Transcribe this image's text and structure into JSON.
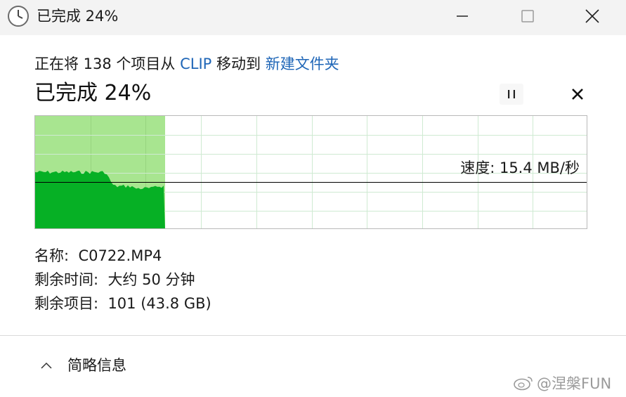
{
  "window": {
    "title": "已完成 24%"
  },
  "summary": {
    "prefix": "正在将 138 个项目从 ",
    "source": "CLIP",
    "middle": " 移动到 ",
    "destination": "新建文件夹"
  },
  "progress": {
    "percent_text": "已完成 24%",
    "percent_value": 24
  },
  "graph": {
    "speed_text": "速度: 15.4 MB/秒",
    "colors": {
      "fill_light": "#a8e590",
      "fill_dark": "#06b025",
      "grid": "#cfead2",
      "line": "#000000"
    }
  },
  "details": {
    "name_label": "名称:",
    "name_value": "C0722.MP4",
    "time_label": "剩余时间:",
    "time_value": "大约 50 分钟",
    "items_label": "剩余项目:",
    "items_value": "101 (43.8 GB)"
  },
  "footer": {
    "toggle_label": "简略信息",
    "toggle_icon": "chevron-up-icon"
  },
  "watermark": {
    "text": "@涅槃FUN"
  },
  "icons": {
    "title": "clock-icon",
    "minimize": "minimize-icon",
    "maximize": "maximize-icon",
    "close": "close-icon",
    "pause": "pause-icon",
    "cancel": "close-icon"
  }
}
